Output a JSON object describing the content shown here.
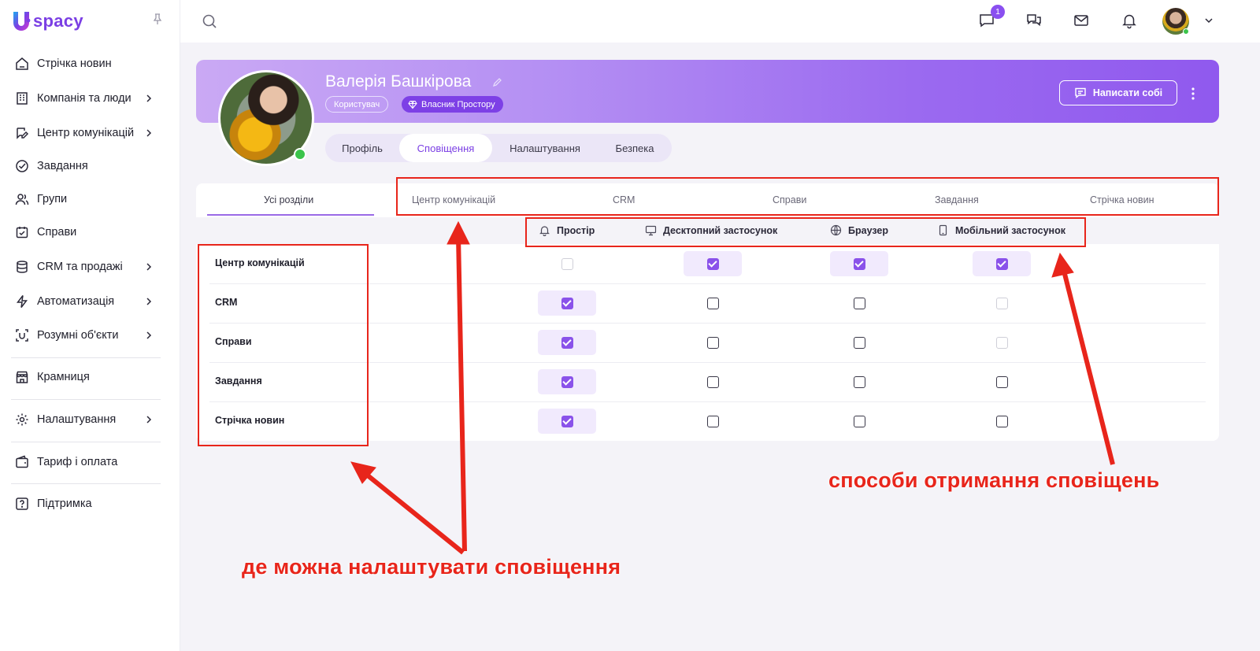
{
  "app": {
    "logo_text": "spacy"
  },
  "sidebar": {
    "items": [
      {
        "label": "Стрічка новин",
        "icon": "home-icon"
      },
      {
        "label": "Компанія та люди",
        "icon": "building-icon"
      },
      {
        "label": "Центр комунікацій",
        "icon": "chat-edit-icon"
      },
      {
        "label": "Завдання",
        "icon": "check-circle-icon"
      },
      {
        "label": "Групи",
        "icon": "users-icon"
      },
      {
        "label": "Справи",
        "icon": "calendar-check-icon"
      },
      {
        "label": "CRM та продажі",
        "icon": "database-icon"
      },
      {
        "label": "Автоматизація",
        "icon": "bolt-icon"
      },
      {
        "label": "Розумні об'єкти",
        "icon": "smart-object-icon"
      },
      {
        "label": "Крамниця",
        "icon": "store-icon"
      },
      {
        "label": "Налаштування",
        "icon": "gear-icon"
      },
      {
        "label": "Тариф і оплата",
        "icon": "wallet-icon"
      },
      {
        "label": "Підтримка",
        "icon": "help-icon"
      }
    ]
  },
  "topbar": {
    "chat_badge": "1"
  },
  "profile": {
    "name": "Валерія Башкірова",
    "role_badge": "Користувач",
    "owner_badge": "Власник Простору",
    "write_self_label": "Написати собі",
    "tabs": [
      "Профіль",
      "Сповіщення",
      "Налаштування",
      "Безпека"
    ],
    "active_tab": "Сповіщення"
  },
  "sections": {
    "tabs": [
      "Усі розділи",
      "Центр комунікацій",
      "CRM",
      "Справи",
      "Завдання",
      "Стрічка новин"
    ],
    "active": "Усі розділи"
  },
  "methods": [
    {
      "label": "Простір",
      "icon": "bell-icon"
    },
    {
      "label": "Десктопний застосунок",
      "icon": "monitor-icon"
    },
    {
      "label": "Браузер",
      "icon": "globe-icon"
    },
    {
      "label": "Мобільний застосунок",
      "icon": "phone-icon"
    }
  ],
  "rows": [
    {
      "label": "Центр комунікацій",
      "values": [
        "disabled",
        "checked",
        "checked",
        "checked"
      ]
    },
    {
      "label": "CRM",
      "values": [
        "checked",
        "unchecked",
        "unchecked",
        "disabled"
      ]
    },
    {
      "label": "Справи",
      "values": [
        "checked",
        "unchecked",
        "unchecked",
        "disabled"
      ]
    },
    {
      "label": "Завдання",
      "values": [
        "checked",
        "unchecked",
        "unchecked",
        "unchecked"
      ]
    },
    {
      "label": "Стрічка новин",
      "values": [
        "checked",
        "unchecked",
        "unchecked",
        "unchecked"
      ]
    }
  ],
  "annotations": {
    "where_text": "де можна налаштувати сповіщення",
    "methods_text": "способи отримання сповіщень"
  },
  "colors": {
    "accent": "#8a52ea",
    "annotation": "#e8251b"
  }
}
